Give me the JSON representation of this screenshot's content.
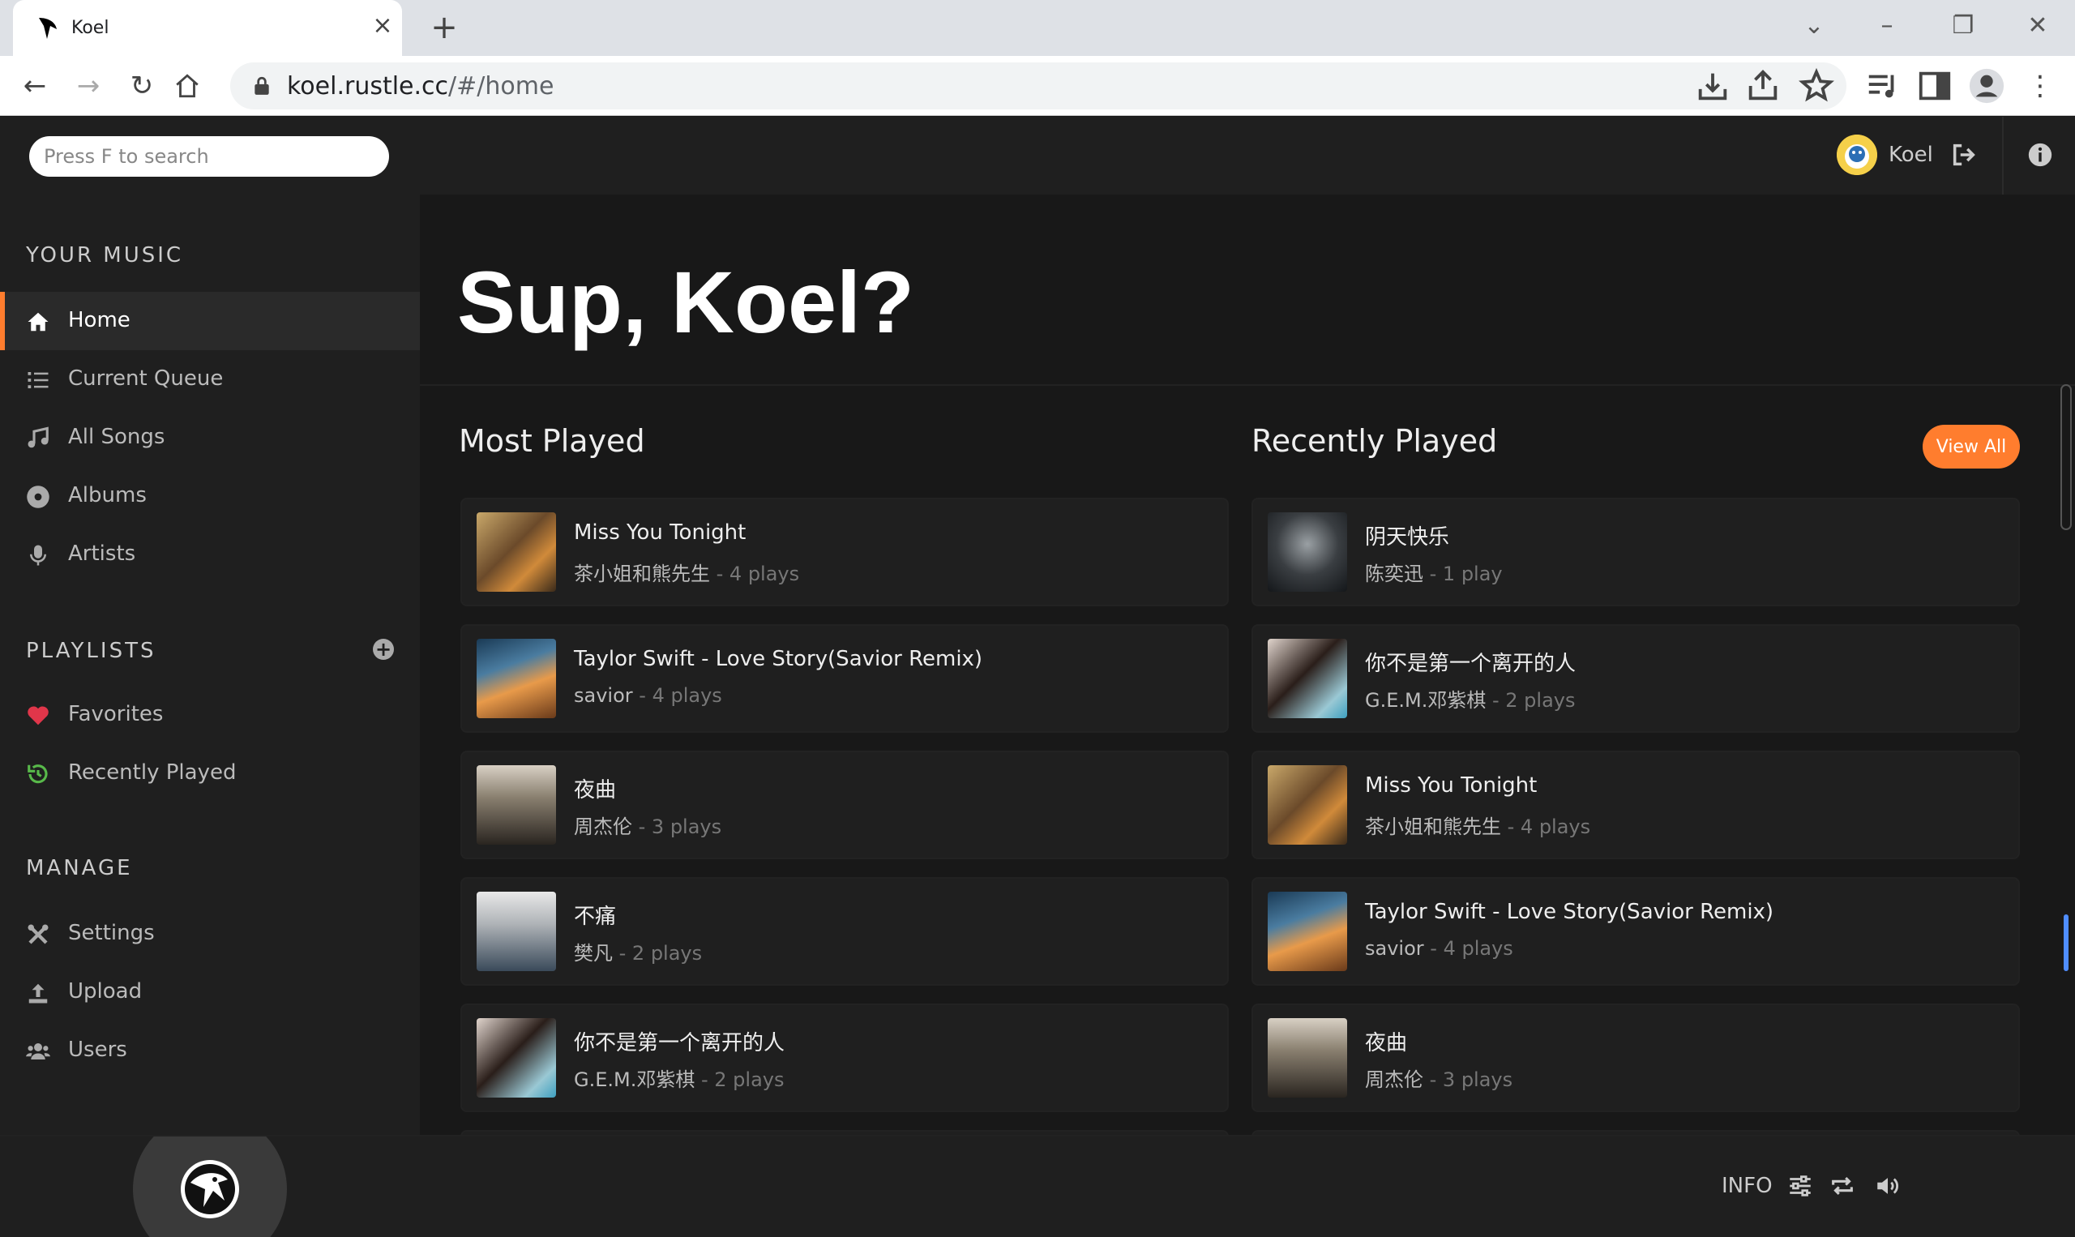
{
  "browser": {
    "tab_title": "Koel",
    "url_host": "koel.rustle.cc",
    "url_path": "/#/home"
  },
  "header": {
    "search_placeholder": "Press F to search",
    "user_name": "Koel"
  },
  "sidebar": {
    "your_music_title": "YOUR MUSIC",
    "music_items": [
      {
        "label": "Home",
        "icon": "home-icon",
        "active": true
      },
      {
        "label": "Current Queue",
        "icon": "queue-icon"
      },
      {
        "label": "All Songs",
        "icon": "music-note-icon"
      },
      {
        "label": "Albums",
        "icon": "disc-icon"
      },
      {
        "label": "Artists",
        "icon": "microphone-icon"
      }
    ],
    "playlists_title": "PLAYLISTS",
    "playlist_items": [
      {
        "label": "Favorites",
        "icon": "heart-icon",
        "color": "#e0364a"
      },
      {
        "label": "Recently Played",
        "icon": "history-icon",
        "color": "#58b94a"
      }
    ],
    "manage_title": "MANAGE",
    "manage_items": [
      {
        "label": "Settings",
        "icon": "tools-icon"
      },
      {
        "label": "Upload",
        "icon": "upload-icon"
      },
      {
        "label": "Users",
        "icon": "users-icon"
      }
    ]
  },
  "main": {
    "greeting": "Sup, Koel?",
    "most_played_title": "Most Played",
    "recently_played_title": "Recently Played",
    "view_all_label": "View All",
    "most_played": [
      {
        "title": "Miss You Tonight",
        "artist": "茶小姐和熊先生",
        "plays": "4 plays"
      },
      {
        "title": "Taylor Swift - Love Story(Savior Remix)",
        "artist": "savior",
        "plays": "4 plays"
      },
      {
        "title": "夜曲",
        "artist": "周杰伦",
        "plays": "3 plays"
      },
      {
        "title": "不痛",
        "artist": "樊凡",
        "plays": "2 plays"
      },
      {
        "title": "你不是第一个离开的人",
        "artist": "G.E.M.邓紫棋",
        "plays": "2 plays"
      }
    ],
    "recently_played": [
      {
        "title": "阴天快乐",
        "artist": "陈奕迅",
        "plays": "1 play"
      },
      {
        "title": "你不是第一个离开的人",
        "artist": "G.E.M.邓紫棋",
        "plays": "2 plays"
      },
      {
        "title": "Miss You Tonight",
        "artist": "茶小姐和熊先生",
        "plays": "4 plays"
      },
      {
        "title": "Taylor Swift - Love Story(Savior Remix)",
        "artist": "savior",
        "plays": "4 plays"
      },
      {
        "title": "夜曲",
        "artist": "周杰伦",
        "plays": "3 plays"
      }
    ]
  },
  "footer": {
    "info_label": "INFO"
  },
  "colors": {
    "accent": "#ff7d2e",
    "background": "#181818",
    "panel": "#1f1f1f"
  }
}
